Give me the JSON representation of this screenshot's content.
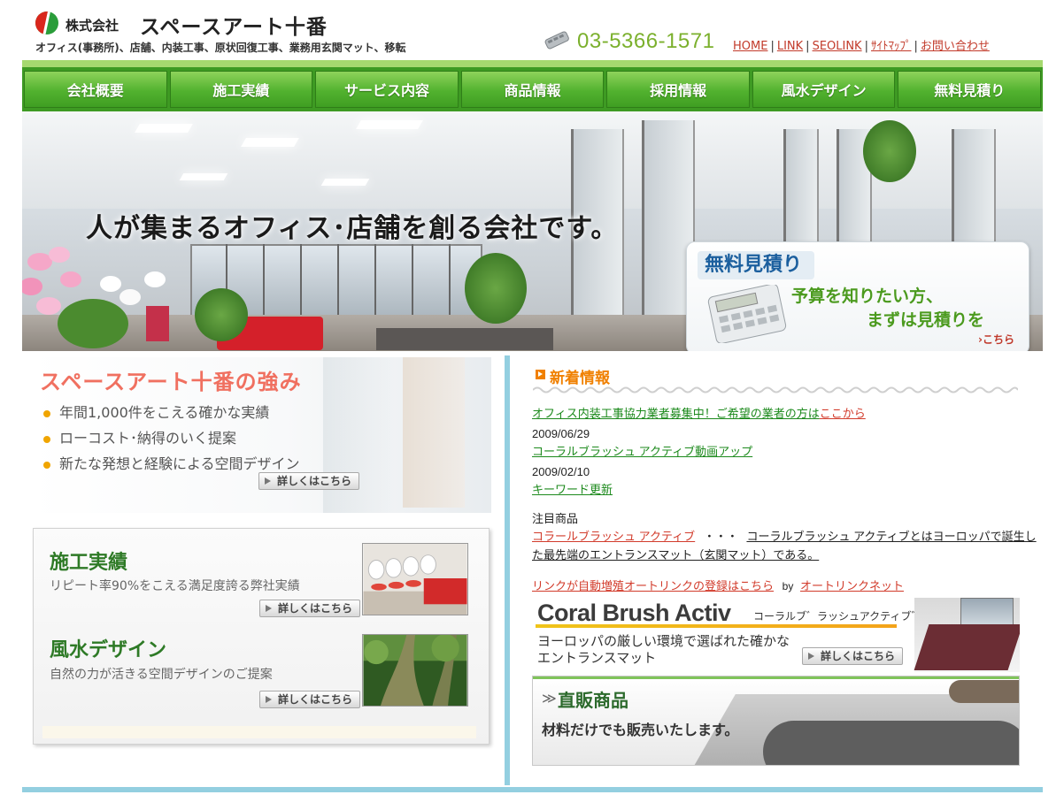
{
  "header": {
    "company_prefix": "株式会社",
    "company_name": "スペースアート十番",
    "tagline": "オフィス(事務所)、店舗、内装工事、原状回復工事、業務用玄関マット、移転",
    "phone": "03-5366-1571",
    "links": [
      {
        "label": "HOME"
      },
      {
        "label": "LINK"
      },
      {
        "label": "SEOLINK"
      },
      {
        "label": "ｻｲﾄﾏｯﾌﾟ"
      },
      {
        "label": "お問い合わせ"
      }
    ],
    "link_separator": "|"
  },
  "nav": {
    "items": [
      {
        "label": "会社概要"
      },
      {
        "label": "施工実績"
      },
      {
        "label": "サービス内容"
      },
      {
        "label": "商品情報"
      },
      {
        "label": "採用情報"
      },
      {
        "label": "風水デザイン"
      },
      {
        "label": "無料見積り"
      }
    ]
  },
  "hero": {
    "headline": "人が集まるオフィス･店舗を創る会社です。",
    "estimate": {
      "title": "無料見積り",
      "line1": "予算を知りたい方、",
      "line2": "まずは見積りを",
      "link": "こちら"
    }
  },
  "strength": {
    "title": "スペースアート十番の強み",
    "points": [
      "年間1,000件をこえる確かな実績",
      "ローコスト･納得のいく提案",
      "新たな発想と経験による空間デザイン"
    ],
    "more": "詳しくはこちら"
  },
  "works": {
    "title": "施工実績",
    "subtitle": "リピート率90%をこえる満足度誇る弊社実績",
    "more": "詳しくはこちら"
  },
  "fengshui": {
    "title": "風水デザイン",
    "subtitle": "自然の力が活きる空間デザインのご提案",
    "more": "詳しくはこちら"
  },
  "news": {
    "title": "新着情報",
    "recruit_text": "オフィス内装工事協力業者募集中！ご希望の業者の方は",
    "recruit_link": "ここから",
    "items": [
      {
        "date": "2009/06/29",
        "text": "コーラルブラッシュ アクティブ動画アップ"
      },
      {
        "date": "2009/02/10",
        "text": "キーワード更新"
      }
    ],
    "featured_label": "注目商品",
    "featured_link": "コラールブラッシュ アクティブ",
    "featured_dots": "・・・",
    "featured_desc1": "コーラルブラッシュ アクティブとはヨーロッパで誕生し",
    "featured_desc2": "た最先端のエントランスマット（玄関マット）である。",
    "autolink_text": "リンクが自動増殖オートリンクの登録はこちら",
    "autolink_by": "by",
    "autolink_site": "オートリンクネット"
  },
  "coral": {
    "title": "Coral Brush Activ",
    "kana": "コーラルブ゛ラッシュアクティブ゛",
    "desc1": "ヨーロッパの厳しい環境で選ばれた確かな",
    "desc2": "エントランスマット",
    "more": "詳しくはこちら"
  },
  "direct": {
    "arrow": "≫",
    "title": "直販商品",
    "subtitle": "材料だけでも販売いたします。"
  },
  "colors": {
    "nav_green": "#52b22f",
    "phone_green": "#7bb02d",
    "link_red": "#c23a2a",
    "news_orange": "#f08000",
    "divider_blue": "#93cfe0"
  }
}
